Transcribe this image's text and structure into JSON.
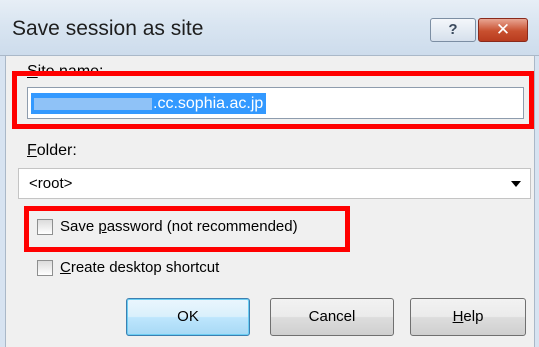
{
  "window": {
    "title": "Save session as site",
    "help_button": "?",
    "close_button": "✕"
  },
  "form": {
    "site_name_label": "Site name:",
    "site_name_value_suffix": ".cc.sophia.ac.jp",
    "folder_label": "Folder:",
    "folder_value": "<root>",
    "save_password_label": "Save password (not recommended)",
    "save_password_checked": false,
    "desktop_shortcut_label": "Create desktop shortcut",
    "desktop_shortcut_checked": false
  },
  "buttons": {
    "ok": "OK",
    "cancel": "Cancel",
    "help": "Help"
  },
  "annotations": {
    "highlight_color": "#ff0000"
  }
}
